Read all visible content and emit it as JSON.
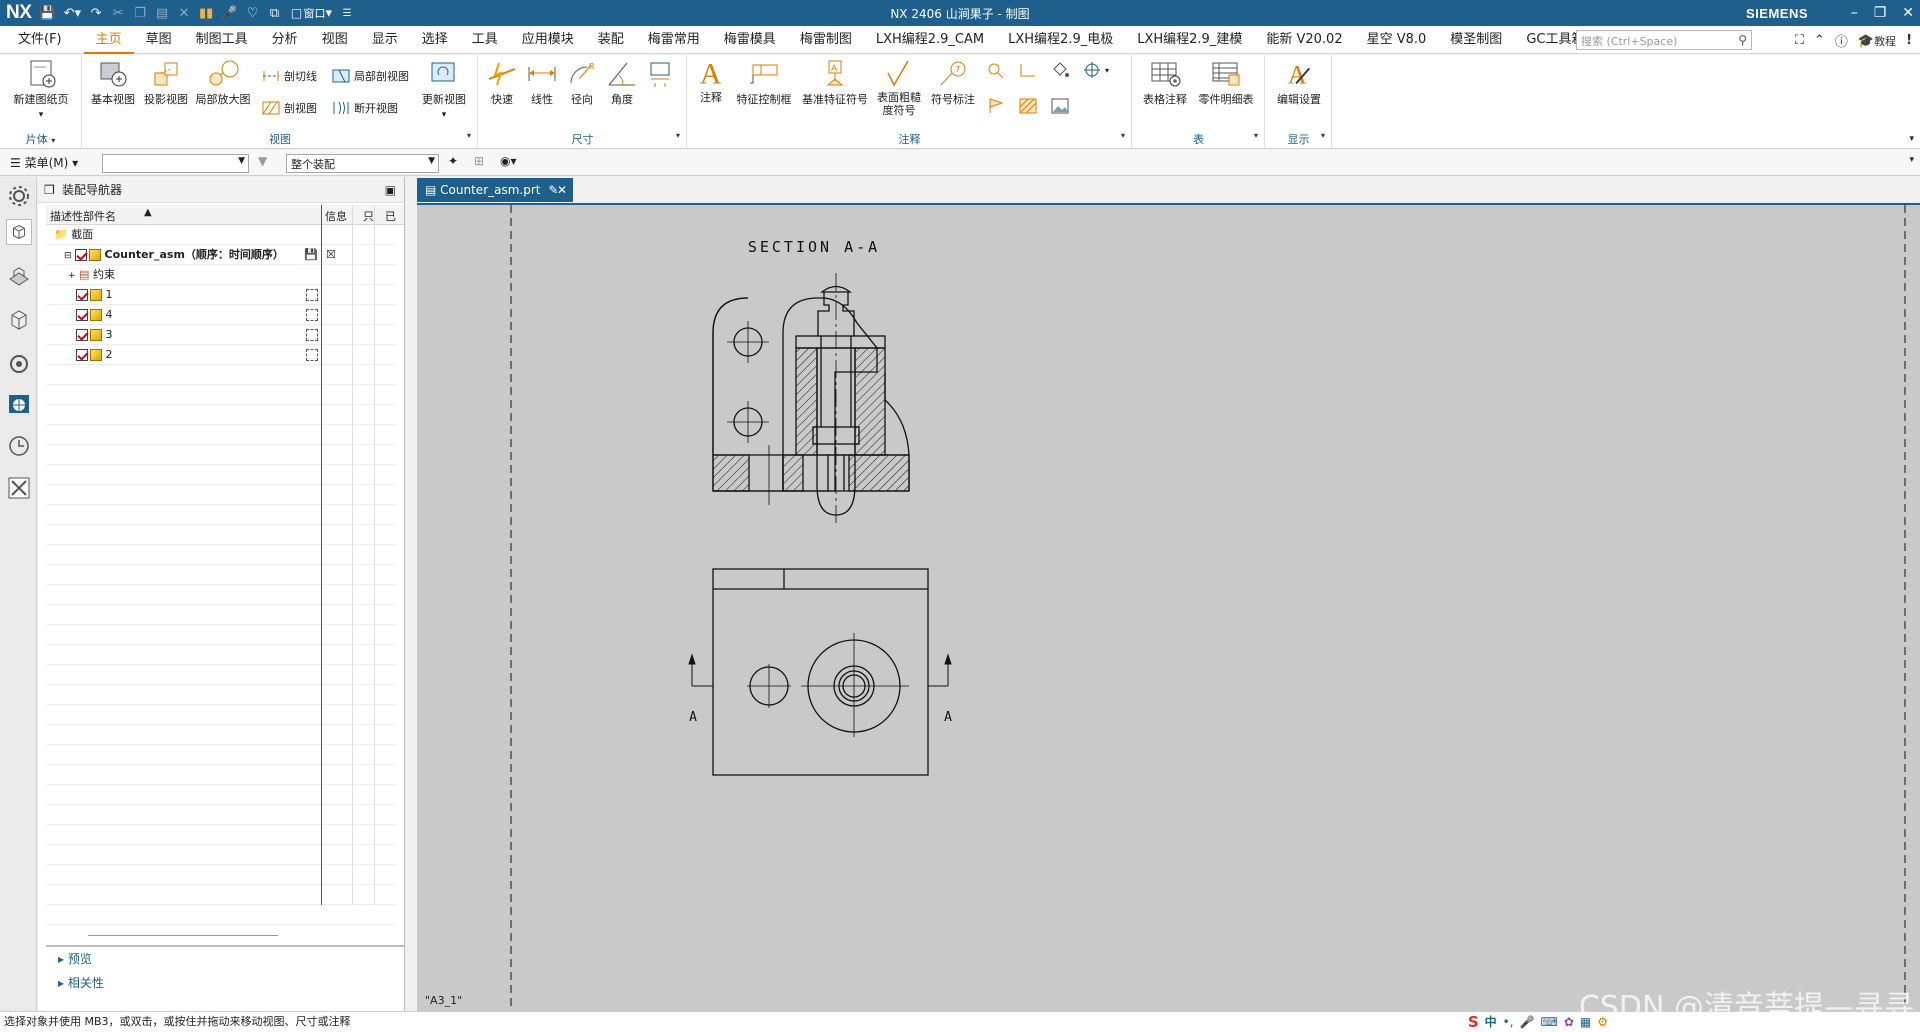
{
  "app": {
    "logo": "NX",
    "title": "NX 2406 山涧果子 - 制图",
    "brand": "SIEMENS",
    "qa_window": "窗口"
  },
  "menubar": {
    "file": "文件(F)",
    "tabs": [
      "主页",
      "草图",
      "制图工具",
      "分析",
      "视图",
      "显示",
      "选择",
      "工具",
      "应用模块",
      "装配",
      "梅雷常用",
      "梅雷模具",
      "梅雷制图",
      "LXH编程2.9_CAM",
      "LXH编程2.9_电极",
      "LXH编程2.9_建模",
      "能新 V20.02",
      "星空 V8.0",
      "模圣制图",
      "GC工具箱"
    ],
    "active_tab": "主页",
    "search_placeholder": "搜索 (Ctrl+Space)",
    "tutorial": "教程"
  },
  "ribbon": {
    "groups": {
      "sheet": "片体",
      "view": "视图",
      "dimension": "尺寸",
      "annotation": "注释",
      "table": "表",
      "display": "显示"
    },
    "buttons": {
      "new_sheet": "新建图纸页",
      "base_view": "基本视图",
      "projected_view": "投影视图",
      "detail_view": "局部放大图",
      "section_line": "剖切线",
      "section_view": "剖视图",
      "local_section": "局部剖视图",
      "break_view": "断开视图",
      "update_view": "更新视图",
      "rapid": "快速",
      "linear": "线性",
      "radial": "径向",
      "angle": "角度",
      "note": "注释",
      "fcf": "特征控制框",
      "datum_symbol": "基准特征符号",
      "surface_finish": "表面粗糙度符号",
      "symbol_label": "符号标注",
      "tabular_note": "表格注释",
      "parts_list": "零件明细表",
      "edit_settings": "编辑设置"
    }
  },
  "toolbar": {
    "menu": "菜单(M)",
    "filter_value": "",
    "scope_value": "整个装配"
  },
  "navigator": {
    "title": "装配导航器",
    "col_name": "描述性部件名",
    "col_info": "信息",
    "col_ro": "只",
    "col_misc": "已",
    "rows": [
      {
        "label": "截面",
        "indent": 1
      },
      {
        "label": "Counter_asm（顺序：时间顺序）",
        "indent": 0
      },
      {
        "label": "约束",
        "indent": 2
      },
      {
        "label": "1",
        "indent": 2
      },
      {
        "label": "4",
        "indent": 2
      },
      {
        "label": "3",
        "indent": 2
      },
      {
        "label": "2",
        "indent": 2
      }
    ],
    "preview": "预览",
    "dependencies": "相关性"
  },
  "document": {
    "tab": "Counter_asm.prt",
    "sheet_name": "\"A3_1\"",
    "section_title": "SECTION  A-A",
    "label_left": "A",
    "label_right": "A"
  },
  "status": {
    "message": "选择对象并使用 MB3，或双击，或按住并拖动来移动视图、尺寸或注释"
  },
  "tray": {
    "ime": "中",
    "punct": "•,"
  },
  "watermark": "CSDN @清音菩提—寻寻",
  "colors": {
    "titlebar": "#1f5f8b",
    "accent": "#e07b00",
    "canvas": "#c9c9c9"
  }
}
